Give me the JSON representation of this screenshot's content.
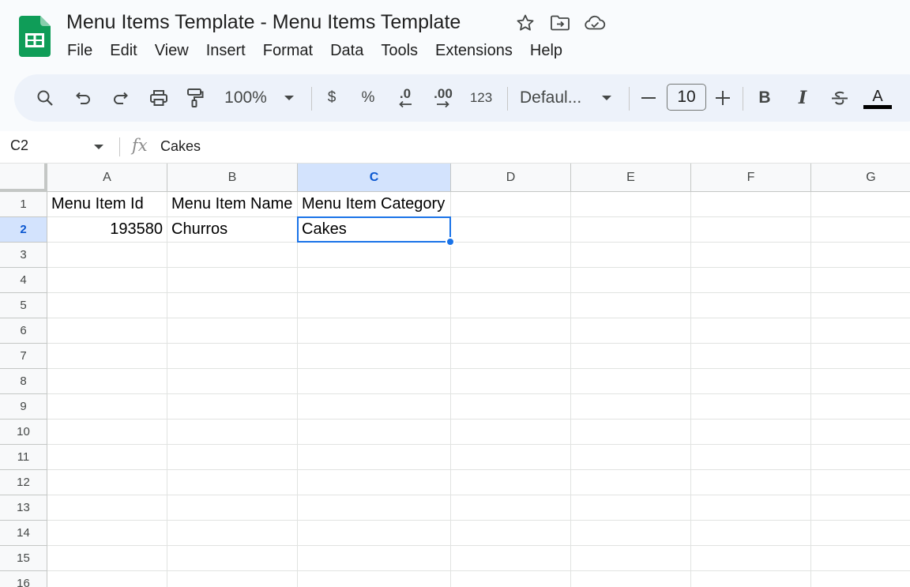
{
  "app": {
    "title": "Menu Items Template - Menu Items Template",
    "logo_icon": "sheets-logo-icon",
    "brand_color": "#0f9d58"
  },
  "menubar": [
    "File",
    "Edit",
    "View",
    "Insert",
    "Format",
    "Data",
    "Tools",
    "Extensions",
    "Help"
  ],
  "toolbar": {
    "zoom": "100%",
    "currency": "$",
    "percent": "%",
    "decrease_decimal": ".0",
    "increase_decimal": ".00",
    "number_format": "123",
    "font": "Defaul...",
    "font_size": "10",
    "bold": "B",
    "italic": "I",
    "text_color": "A"
  },
  "formula_bar": {
    "cell_ref": "C2",
    "fx": "fx",
    "value": "Cakes"
  },
  "grid": {
    "columns": [
      "A",
      "B",
      "C",
      "D",
      "E",
      "F",
      "G"
    ],
    "selected_column": "C",
    "rows": [
      "1",
      "2",
      "3",
      "4",
      "5",
      "6",
      "7",
      "8",
      "9",
      "10",
      "11",
      "12",
      "13",
      "14",
      "15",
      "16"
    ],
    "selected_row": "2",
    "cells": {
      "A1": "Menu Item Id",
      "B1": "Menu Item Name",
      "C1": "Menu Item Category",
      "A2": "193580",
      "B2": "Churros",
      "C2": "Cakes"
    },
    "selection_color": "#1a73e8"
  }
}
